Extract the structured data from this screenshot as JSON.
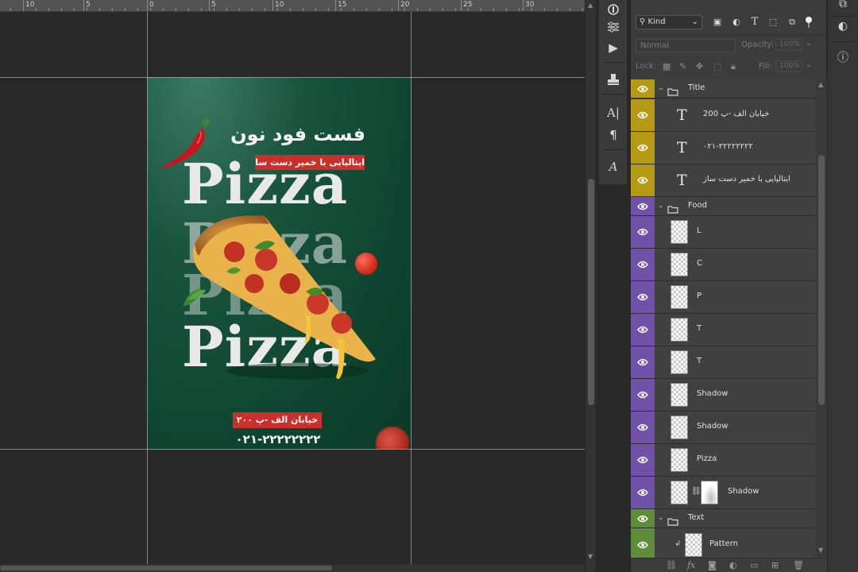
{
  "ruler": {
    "labels": [
      "10",
      "5",
      "0",
      "5",
      "10",
      "15",
      "20",
      "25",
      "30"
    ]
  },
  "poster": {
    "title": "فست فود نون",
    "subtitle": "ایتالیایی با خمیر دست ساز",
    "pizza_word": "Pizza",
    "address": "خیابان الف -پ ۲۰۰",
    "phone": "۰۲۱-۲۲۲۲۲۲۲۲",
    "colors": {
      "background": "#0f4530",
      "banner": "#c9302c",
      "text": "#e9e9e9"
    }
  },
  "toolbar": {
    "icons": [
      "properties-icon",
      "adjustments-icon",
      "play-icon",
      "stamp-icon",
      "character-icon",
      "paragraph-icon",
      "glyphs-icon"
    ]
  },
  "layers_panel": {
    "filter": {
      "kind_label": "Kind"
    },
    "blend": {
      "mode": "Normal",
      "opacity_label": "Opacity:",
      "opacity_value": "100%"
    },
    "lock": {
      "lock_label": "Lock:",
      "fill_label": "Fill:",
      "fill_value": "100%"
    },
    "rows": [
      {
        "name": "Title",
        "kind": "group",
        "color": "yellow"
      },
      {
        "name": "خیابان الف -پ 200",
        "kind": "text",
        "color": "yellow"
      },
      {
        "name": "۰۲۱-۲۲۲۲۲۲۲۲",
        "kind": "text",
        "color": "yellow"
      },
      {
        "name": "ایتالیایی با خمیر دست ساز",
        "kind": "text",
        "color": "yellow"
      },
      {
        "name": "Food",
        "kind": "group",
        "color": "purple"
      },
      {
        "name": "L",
        "kind": "layer",
        "color": "purple"
      },
      {
        "name": "C",
        "kind": "layer",
        "color": "purple"
      },
      {
        "name": "P",
        "kind": "layer",
        "color": "purple"
      },
      {
        "name": "T",
        "kind": "layer",
        "color": "purple"
      },
      {
        "name": "T",
        "kind": "layer",
        "color": "purple"
      },
      {
        "name": "Shadow",
        "kind": "layer",
        "color": "purple"
      },
      {
        "name": "Shadow",
        "kind": "layer",
        "color": "purple"
      },
      {
        "name": "Pizza",
        "kind": "layer",
        "color": "purple"
      },
      {
        "name": "Shadow",
        "kind": "masked",
        "color": "purple"
      },
      {
        "name": "Text",
        "kind": "group",
        "color": "green"
      },
      {
        "name": "Pattern",
        "kind": "clipped",
        "color": "green"
      }
    ],
    "label_colors": {
      "yellow": "#b59a14",
      "purple": "#6f51a8",
      "green": "#5d8c3a"
    },
    "bottom_icons": [
      "link-icon",
      "fx-icon",
      "mask-icon",
      "adjustment-icon",
      "folder-icon",
      "new-layer-icon",
      "trash-icon"
    ]
  },
  "dock": {
    "icons": [
      "layers-icon",
      "adjust-icon",
      "info-icon"
    ]
  }
}
